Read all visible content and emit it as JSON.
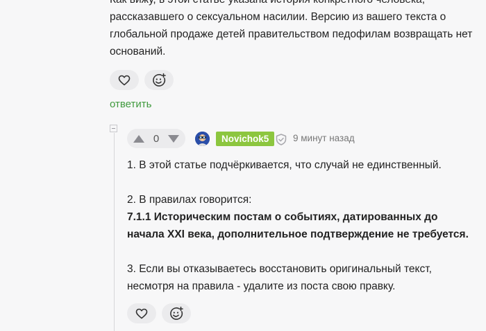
{
  "parent_comment": {
    "lines": [
      "Как вижу, в этой статье указана история конкретного человека,",
      "рассказавшего о сексуальном насилии. Версию из вашего текста о",
      "глобальной продаже детей правительством педофилам возвращать нет",
      "оснований."
    ],
    "reply_label": "ответить"
  },
  "reply_comment": {
    "vote_count": "0",
    "username": "Novichok5",
    "time_ago": "9 минут назад",
    "paragraph_1": "1. В этой статье подчёркивается, что случай не единственный.",
    "paragraph_2_intro": "2. В правилах говорится:",
    "paragraph_2_rule": "7.1.1 Историческим постам о событиях, датированных до начала XXI века, дополнительное подтверждение не требуется.",
    "paragraph_3": "3. Если вы отказываетесь восстановить оригинальный текст, несмотря на правила - удалите из поста свою правку."
  },
  "icons": {
    "like": "heart-icon",
    "reaction": "add-emoji-icon",
    "upvote": "triangle-up-icon",
    "downvote": "triangle-down-icon",
    "verified": "shield-icon"
  },
  "colors": {
    "accent_green": "#3f9a3d",
    "username_badge": "#8cc63f",
    "button_bg": "#ebebed",
    "page_bg": "#f7f7f8"
  }
}
